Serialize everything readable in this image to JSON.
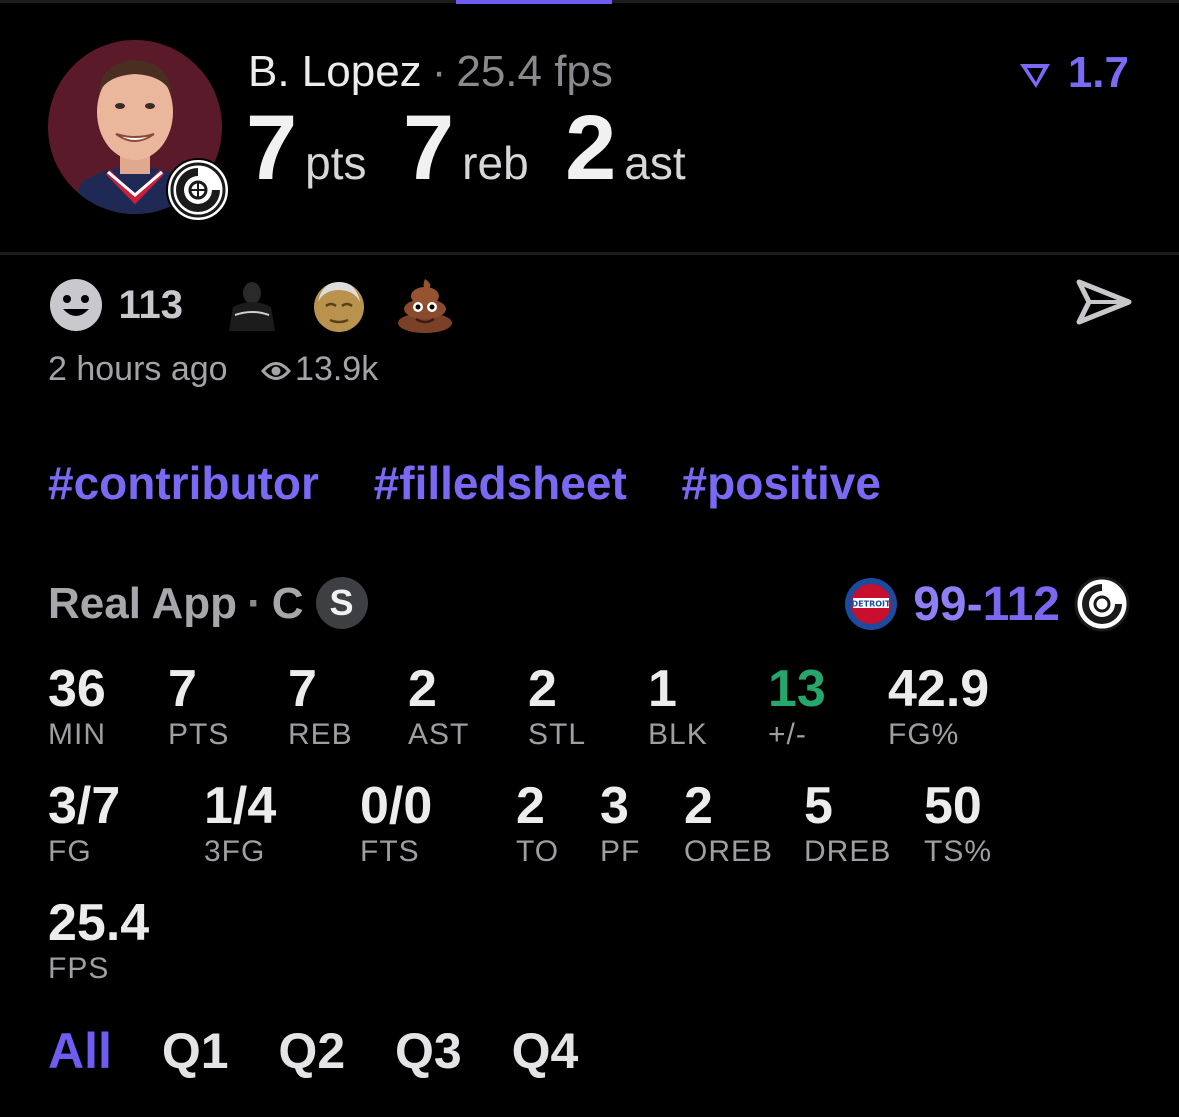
{
  "colors": {
    "accent": "#6f5cf0",
    "positive": "#26a66b",
    "background": "#000000"
  },
  "player": {
    "name": "B. Lopez",
    "fps": "25.4 fps",
    "separator": "·",
    "trend_value": "1.7",
    "big_stats": [
      {
        "value": "7",
        "unit": "pts"
      },
      {
        "value": "7",
        "unit": "reb"
      },
      {
        "value": "2",
        "unit": "ast"
      }
    ]
  },
  "reactions": {
    "count": "113",
    "emojis": [
      "player-sticker-icon",
      "old-face-emoji-icon",
      "poop-emoji-icon"
    ]
  },
  "post_meta": {
    "time_ago": "2 hours ago",
    "views": "13.9k"
  },
  "tags": [
    "#contributor",
    "#filledsheet",
    "#positive"
  ],
  "game": {
    "source": "Real App",
    "position": "C",
    "separator": "·",
    "badge": "S",
    "score_opponent": "99",
    "score_dash": "-",
    "score_team": "112"
  },
  "stats_row1": [
    {
      "value": "36",
      "label": "MIN"
    },
    {
      "value": "7",
      "label": "PTS"
    },
    {
      "value": "7",
      "label": "REB"
    },
    {
      "value": "2",
      "label": "AST"
    },
    {
      "value": "2",
      "label": "STL"
    },
    {
      "value": "1",
      "label": "BLK"
    },
    {
      "value": "13",
      "label": "+/-"
    },
    {
      "value": "42.9",
      "label": "FG%"
    }
  ],
  "stats_row2": [
    {
      "value": "3/7",
      "label": "FG"
    },
    {
      "value": "1/4",
      "label": "3FG"
    },
    {
      "value": "0/0",
      "label": "FTS"
    },
    {
      "value": "2",
      "label": "TO"
    },
    {
      "value": "3",
      "label": "PF"
    },
    {
      "value": "2",
      "label": "OREB"
    },
    {
      "value": "5",
      "label": "DREB"
    },
    {
      "value": "50",
      "label": "TS%"
    }
  ],
  "stats_row3": [
    {
      "value": "25.4",
      "label": "FPS"
    }
  ],
  "quarter_tabs": [
    {
      "label": "All",
      "active": true
    },
    {
      "label": "Q1",
      "active": false
    },
    {
      "label": "Q2",
      "active": false
    },
    {
      "label": "Q3",
      "active": false
    },
    {
      "label": "Q4",
      "active": false
    }
  ]
}
